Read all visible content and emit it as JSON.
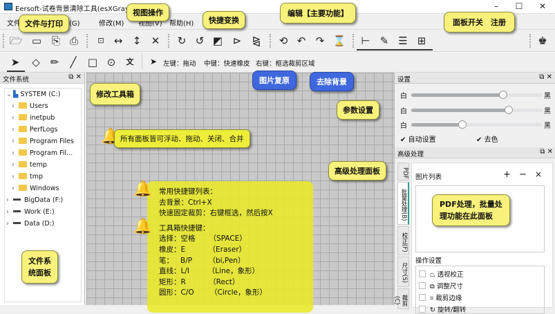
{
  "window": {
    "title": "Eersoft-试卷背景清除工具(esXGray)",
    "min": "–",
    "max": "☐",
    "close": "✕"
  },
  "menu": [
    "文件(F)",
    "处理(G)",
    "修改(M)",
    "视图(V)",
    "帮助(H)"
  ],
  "toolbar": {
    "hint_left": "左键：拖动",
    "hint_middle": "中键：快速橡皮",
    "hint_right": "右键：框选裁剪区域",
    "text_tool": "文"
  },
  "file_panel": {
    "title": "文件系统",
    "tree": [
      {
        "label": "SYSTEM (C:)",
        "type": "drive",
        "expanded": true,
        "children": [
          "Users",
          "inetpub",
          "PerfLogs",
          "Program Files",
          "Program Fil...",
          "temp",
          "tmp",
          "Windows"
        ]
      },
      {
        "label": "BigData (F:)",
        "type": "drive"
      },
      {
        "label": "Work (E:)",
        "type": "drive"
      },
      {
        "label": "Data (D:)",
        "type": "drive"
      }
    ]
  },
  "settings_panel": {
    "title": "设置",
    "sliders": [
      {
        "left": "白",
        "right": "黑",
        "value": 0.7
      },
      {
        "left": "白",
        "right": "黑",
        "value": 0.74
      },
      {
        "left": "白",
        "right": "黑",
        "value": 0.39
      }
    ],
    "checkboxes": [
      {
        "label": "自动设置",
        "checked": true
      },
      {
        "label": "去色",
        "checked": true
      }
    ]
  },
  "advanced_panel": {
    "title": "高级处理",
    "tabs": [
      "PDF",
      "批量处理(B)",
      "校正(F)",
      "尺寸(S)",
      "裁剪(C)"
    ],
    "list_title": "图片列表",
    "add": "+",
    "remove": "−",
    "clear": "×",
    "ops_title": "操作设置",
    "ops": [
      "透视校正",
      "调整尺寸",
      "裁剪边缘",
      "旋转/翻转"
    ]
  },
  "callouts": {
    "file_print": "文件与打印",
    "view_ops": "视图操作",
    "quick_transform": "快捷变换",
    "edit_main": "编辑【主要功能】",
    "panel_switch": "面板开关　注册",
    "modify_toolbox": "修改工具箱",
    "restore": "图片复原",
    "remove_bg": "去除背景",
    "params": "参数设置",
    "floating": "所有面板皆可浮动、拖动、关闭、合并",
    "advanced": "高级处理面板",
    "pdf_note": [
      "PDF处理，批量处",
      "理功能在此面板"
    ],
    "fs_note": [
      "文件系",
      "统面板"
    ]
  },
  "shortcuts": [
    "常用快捷键列表：",
    "去背景：Ctrl+X",
    "快速固定裁剪：右键框选，然后按X",
    "",
    "工具箱快捷键：",
    "选择：空格      （SPACE）",
    "橡皮：E          （Eraser）",
    "笔：   B/P       （bi,Pen）",
    "直线：L/I        （Line，象形）",
    "矩形：R          （Rect）",
    "圆形：C/O       （Circle，象形）"
  ],
  "colors": {
    "callout_yellow": "#f8f27c",
    "callout_blue": "#3f68de"
  }
}
